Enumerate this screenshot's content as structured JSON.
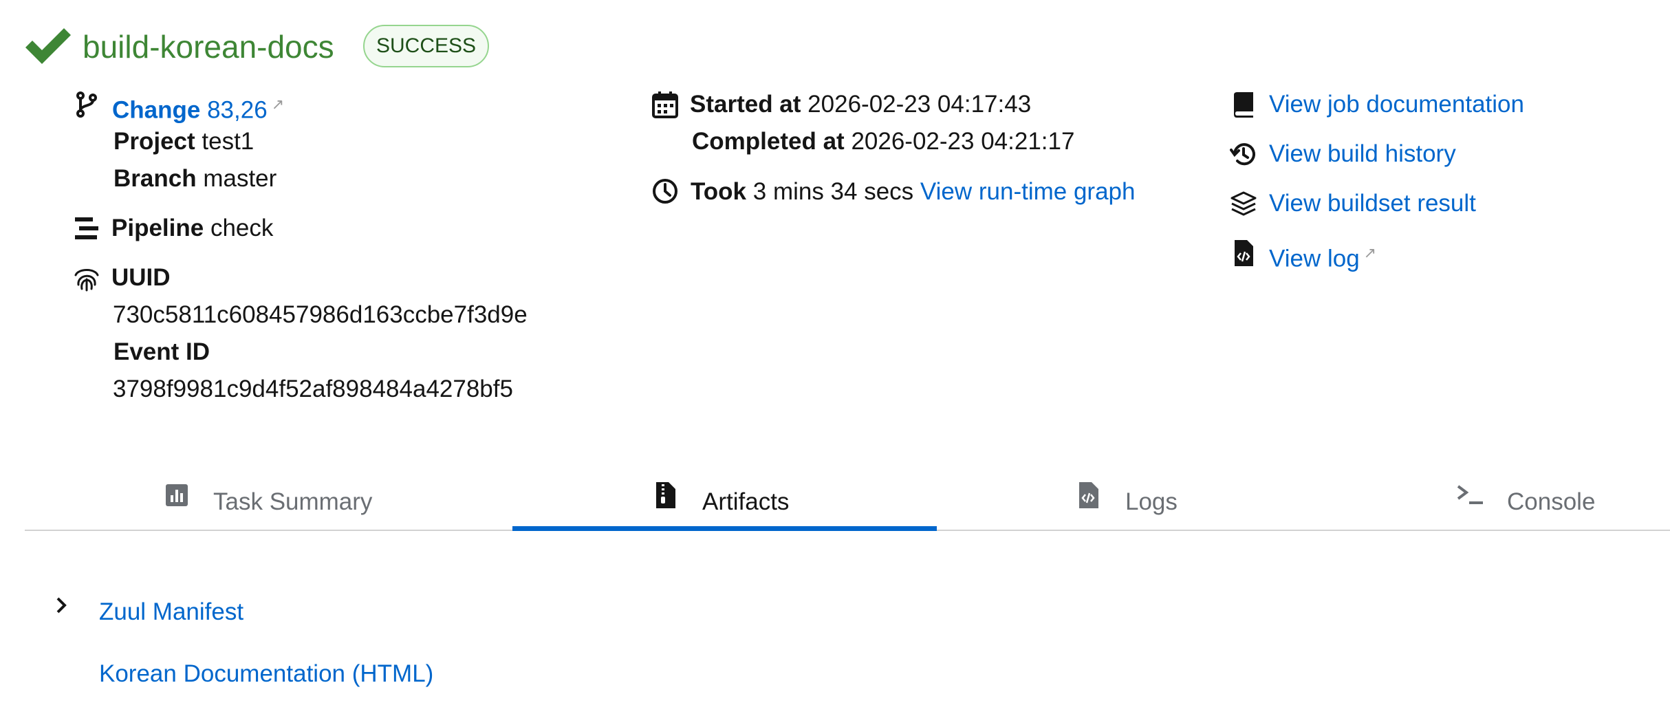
{
  "header": {
    "job_name": "build-korean-docs",
    "status": "SUCCESS"
  },
  "details": {
    "change_label": "Change",
    "change_value": "83,26",
    "project_label": "Project",
    "project_value": "test1",
    "branch_label": "Branch",
    "branch_value": "master",
    "pipeline_label": "Pipeline",
    "pipeline_value": "check",
    "uuid_label": "UUID",
    "uuid_value": "730c5811c608457986d163ccbe7f3d9e",
    "event_label": "Event ID",
    "event_value": "3798f9981c9d4f52af898484a4278bf5"
  },
  "timing": {
    "started_label": "Started at",
    "started_value": "2026-02-23 04:17:43",
    "completed_label": "Completed at",
    "completed_value": "2026-02-23 04:21:17",
    "took_label": "Took",
    "took_value": "3 mins 34 secs",
    "graph_link": "View run-time graph"
  },
  "links": {
    "job_docs": "View job documentation",
    "build_history": "View build history",
    "buildset_result": "View buildset result",
    "log": "View log"
  },
  "tabs": [
    {
      "label": "Task Summary",
      "icon": "bar-chart-icon",
      "active": false
    },
    {
      "label": "Artifacts",
      "icon": "file-archive-icon",
      "active": true
    },
    {
      "label": "Logs",
      "icon": "file-code-icon",
      "active": false
    },
    {
      "label": "Console",
      "icon": "terminal-icon",
      "active": false
    }
  ],
  "artifacts": [
    {
      "label": "Zuul Manifest",
      "expandable": true
    },
    {
      "label": "Korean Documentation (HTML)",
      "expandable": false
    }
  ],
  "colors": {
    "success_green": "#3e8635",
    "link_blue": "#0066cc",
    "badge_border": "#95d58e",
    "badge_text": "#1e4f18"
  }
}
